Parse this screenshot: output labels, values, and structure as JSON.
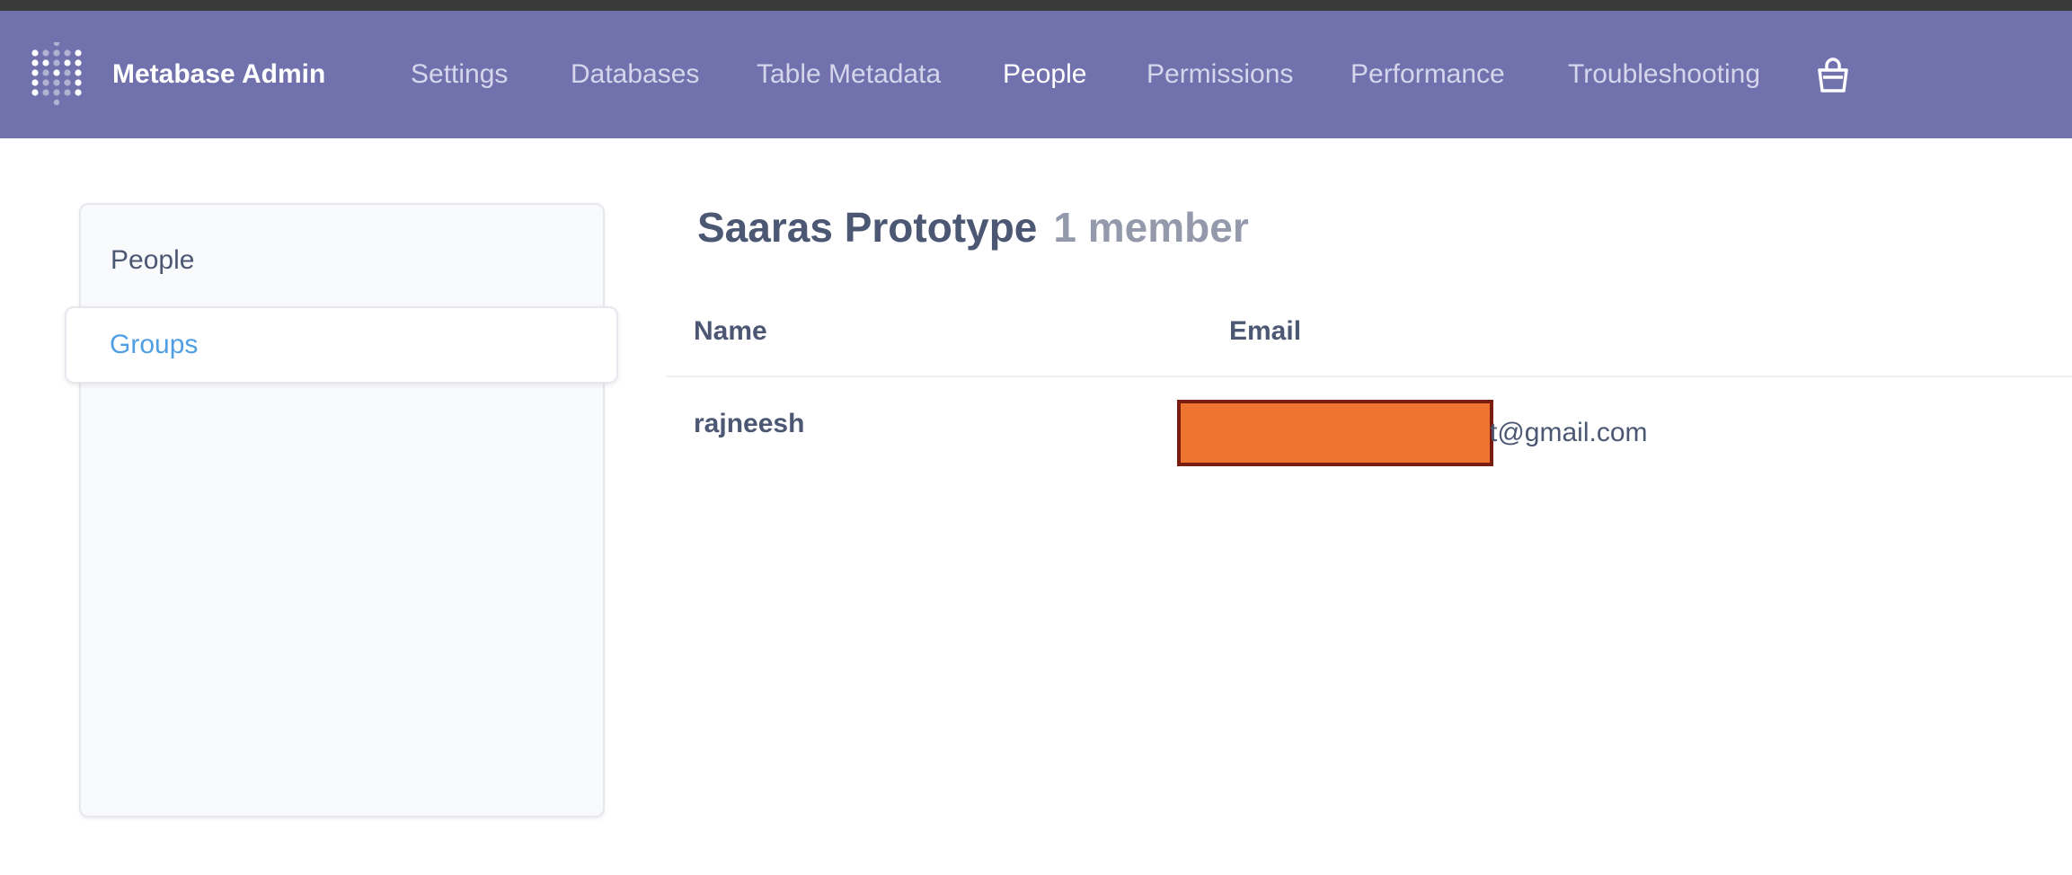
{
  "nav": {
    "brand": "Metabase Admin",
    "items": [
      {
        "label": "Settings",
        "active": false
      },
      {
        "label": "Databases",
        "active": false
      },
      {
        "label": "Table Metadata",
        "active": false
      },
      {
        "label": "People",
        "active": true
      },
      {
        "label": "Permissions",
        "active": false
      },
      {
        "label": "Performance",
        "active": false
      },
      {
        "label": "Troubleshooting",
        "active": false
      }
    ],
    "icons": {
      "logo": "metabase-logo-icon",
      "store": "shopping-bag-icon"
    },
    "colors": {
      "bar": "#7172ad",
      "active": "#ffffff",
      "inactive": "#d5d6ec"
    }
  },
  "sidebar": {
    "items": [
      {
        "label": "People",
        "selected": false
      },
      {
        "label": "Groups",
        "selected": true
      }
    ]
  },
  "group": {
    "name": "Saaras Prototype",
    "member_count": "1 member"
  },
  "table": {
    "columns": [
      "Name",
      "Email"
    ],
    "rows": [
      {
        "name": "rajneesh",
        "email_visible": "t@gmail.com",
        "email_redacted": true
      }
    ]
  },
  "colors": {
    "text": "#4c5773",
    "muted": "#949aab",
    "accent": "#509ee3",
    "redaction": "#ee7430"
  }
}
